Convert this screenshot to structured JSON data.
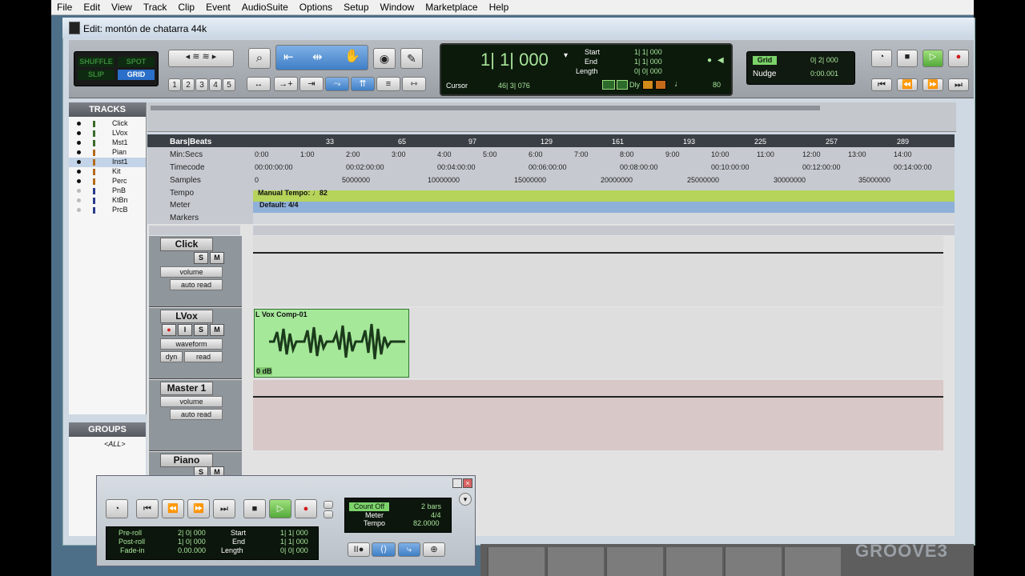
{
  "menu": [
    "File",
    "Edit",
    "View",
    "Track",
    "Clip",
    "Event",
    "AudioSuite",
    "Options",
    "Setup",
    "Window",
    "Marketplace",
    "Help"
  ],
  "window_title": "Edit: montón de chatarra 44k",
  "edit_modes": {
    "shuffle": "SHUFFLE",
    "spot": "SPOT",
    "slip": "SLIP",
    "grid": "GRID"
  },
  "zoom_presets": [
    "1",
    "2",
    "3",
    "4",
    "5"
  ],
  "counter": {
    "main": "1| 1| 000",
    "start_label": "Start",
    "end_label": "End",
    "length_label": "Length",
    "start": "1| 1| 000",
    "end": "1| 1| 000",
    "length": "0| 0| 000",
    "cursor_label": "Cursor",
    "cursor": "46| 3| 076",
    "dly": "Dly",
    "tempo_val": "80"
  },
  "grid": {
    "label": "Grid",
    "value": "0| 2| 000",
    "nudge_label": "Nudge",
    "nudge_value": "0:00.001"
  },
  "tracks_panel": {
    "title": "TRACKS",
    "items": [
      "Click",
      "LVox",
      "Mst1",
      "Pian",
      "Inst1",
      "Kit",
      "Perc",
      "PnB",
      "KtBn",
      "PrcB"
    ]
  },
  "groups_panel": {
    "title": "GROUPS",
    "items": [
      "<ALL>"
    ]
  },
  "rulers": {
    "labels": [
      "Bars|Beats",
      "Min:Secs",
      "Timecode",
      "Samples",
      "Tempo",
      "Meter",
      "Markers"
    ],
    "bars": [
      "33",
      "65",
      "97",
      "129",
      "161",
      "193",
      "225",
      "257",
      "289"
    ],
    "minsecs": [
      "0:00",
      "1:00",
      "2:00",
      "3:00",
      "4:00",
      "5:00",
      "6:00",
      "7:00",
      "8:00",
      "9:00",
      "10:00",
      "11:00",
      "12:00",
      "13:00",
      "14:00"
    ],
    "timecode": [
      "00:00:00:00",
      "00:02:00:00",
      "00:04:00:00",
      "00:06:00:00",
      "00:08:00:00",
      "00:10:00:00",
      "00:12:00:00",
      "00:14:00:00"
    ],
    "samples": [
      "0",
      "5000000",
      "10000000",
      "15000000",
      "20000000",
      "25000000",
      "30000000",
      "35000000"
    ],
    "tempo_text": "Manual Tempo: ♩82",
    "meter_text": "Default: 4/4"
  },
  "tracks": [
    {
      "name": "Click",
      "view": "volume",
      "auto": "auto read"
    },
    {
      "name": "LVox",
      "view": "waveform",
      "auto": "read",
      "dyn": "dyn",
      "clip": "L Vox Comp-01",
      "clip_gain": "0 dB"
    },
    {
      "name": "Master 1",
      "view": "volume",
      "auto": "auto read"
    },
    {
      "name": "Piano"
    }
  ],
  "transport": {
    "count_off": "Count Off",
    "count_bars": "2 bars",
    "meter_label": "Meter",
    "meter_val": "4/4",
    "tempo_label": "Tempo",
    "tempo_val": "82.0000",
    "preroll_label": "Pre-roll",
    "preroll": "2| 0| 000",
    "postroll_label": "Post-roll",
    "postroll": "1| 0| 000",
    "fadein_label": "Fade-in",
    "fadein": "0.00.000",
    "start_label": "Start",
    "start": "1| 1| 000",
    "end_label": "End",
    "end": "1| 1| 000",
    "length_label": "Length",
    "length": "0| 0| 000"
  },
  "watermark": "GROOVE3",
  "colors": {
    "lcd_green": "#a8e59a",
    "clip_green": "#a6e89a",
    "tempo_ruler": "#b6d45a",
    "meter_ruler": "#8fb0d8",
    "record_red": "#d21b1b"
  }
}
